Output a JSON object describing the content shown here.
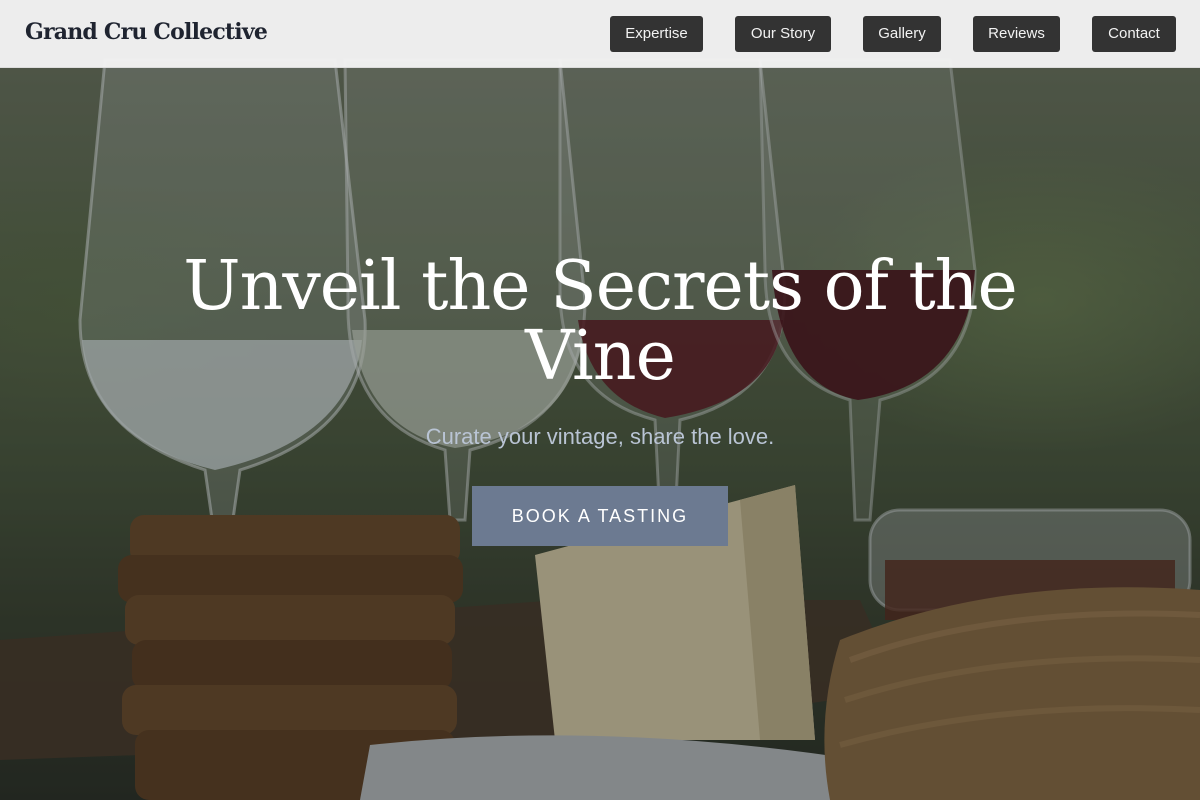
{
  "brand": {
    "name": "Grand Cru Collective"
  },
  "nav": {
    "items": [
      {
        "label": "Expertise"
      },
      {
        "label": "Our Story"
      },
      {
        "label": "Gallery"
      },
      {
        "label": "Reviews"
      },
      {
        "label": "Contact"
      }
    ],
    "button_bg": "#333333"
  },
  "hero": {
    "title": "Unveil the Secrets of the Vine",
    "subtitle": "Curate your vintage, share the love.",
    "cta_label": "BOOK A TASTING",
    "cta_color": "#6c7a91",
    "background_image": "wine-glasses-cheese-crackers-photo"
  }
}
